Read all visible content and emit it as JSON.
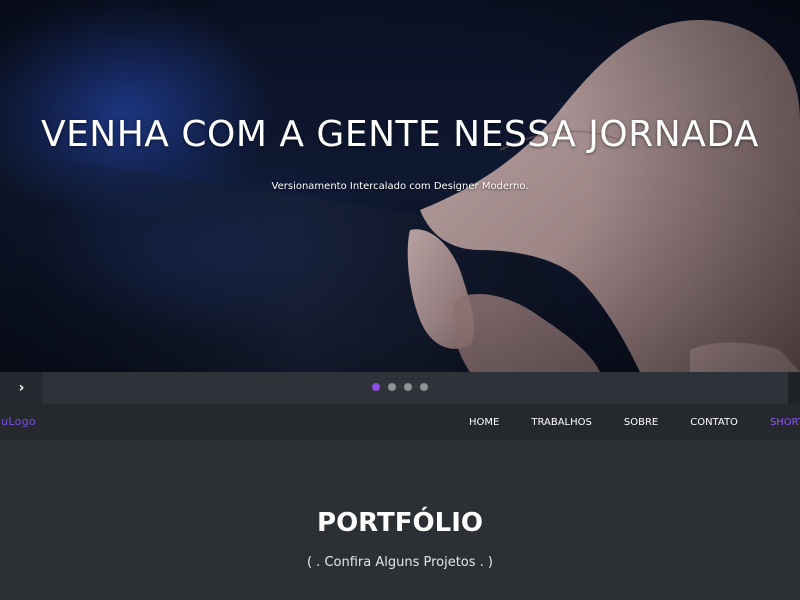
{
  "hero": {
    "title": "VENHA COM A GENTE NESSA JORNADA",
    "subtitle": "Versionamento Intercalado com Designer Moderno."
  },
  "slider": {
    "next_icon": "chevron-right-icon",
    "next_glyph": "›",
    "dots": 4,
    "active_dot": 1,
    "active_color": "#8a4fe0"
  },
  "nav": {
    "logo": "SeuLogo",
    "logo_visible": "euLogo",
    "items": [
      {
        "label": "HOME"
      },
      {
        "label": "TRABALHOS"
      },
      {
        "label": "SOBRE"
      },
      {
        "label": "CONTATO"
      },
      {
        "label": "SHORTCODE"
      }
    ],
    "accent_color": "#8a5cf0"
  },
  "portfolio": {
    "title": "PORTFÓLIO",
    "subtitle": "( . Confira Alguns Projetos . )"
  }
}
